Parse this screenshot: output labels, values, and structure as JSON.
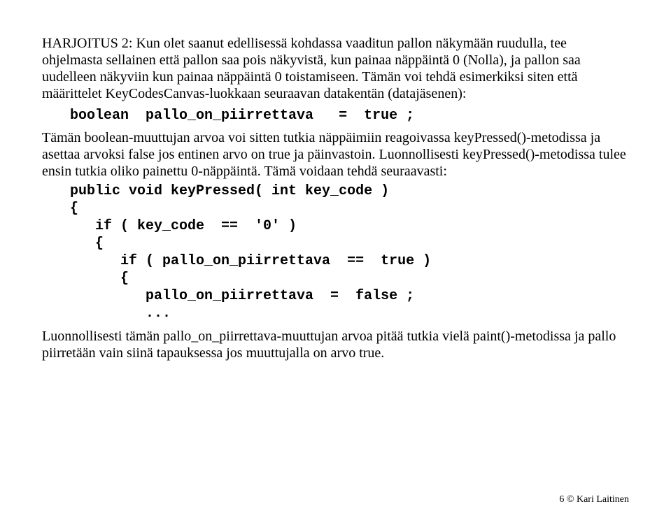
{
  "para1": "HARJOITUS 2:  Kun olet saanut edellisessä kohdassa vaaditun pallon näkymään ruudulla, tee ohjelmasta sellainen että pallon saa pois näkyvistä, kun painaa näppäintä 0 (Nolla), ja pallon saa uudelleen näkyviin kun painaa näppäintä 0 toistamiseen. Tämän voi tehdä esimerkiksi siten että määrittelet KeyCodesCanvas-luokkaan seuraavan datakentän (datajäsenen):",
  "code1": "boolean  pallo_on_piirrettava   =  true ;",
  "para2": "Tämän boolean-muuttujan arvoa voi sitten tutkia näppäimiin reagoivassa keyPressed()-metodissa ja asettaa arvoksi false jos entinen arvo on true ja päinvastoin. Luonnollisesti keyPressed()-metodissa tulee ensin tutkia oliko painettu 0-näppäintä. Tämä voidaan tehdä seuraavasti:",
  "code2": "public void keyPressed( int key_code )\n{\n   if ( key_code  ==  '0' )\n   {\n      if ( pallo_on_piirrettava  ==  true )\n      {\n         pallo_on_piirrettava  =  false ;\n         ...",
  "para3": "Luonnollisesti tämän pallo_on_piirrettava-muuttujan arvoa pitää tutkia vielä paint()-metodissa ja pallo piirretään vain siinä tapauksessa jos muuttujalla on arvo true.",
  "footer": "6 © Kari Laitinen"
}
